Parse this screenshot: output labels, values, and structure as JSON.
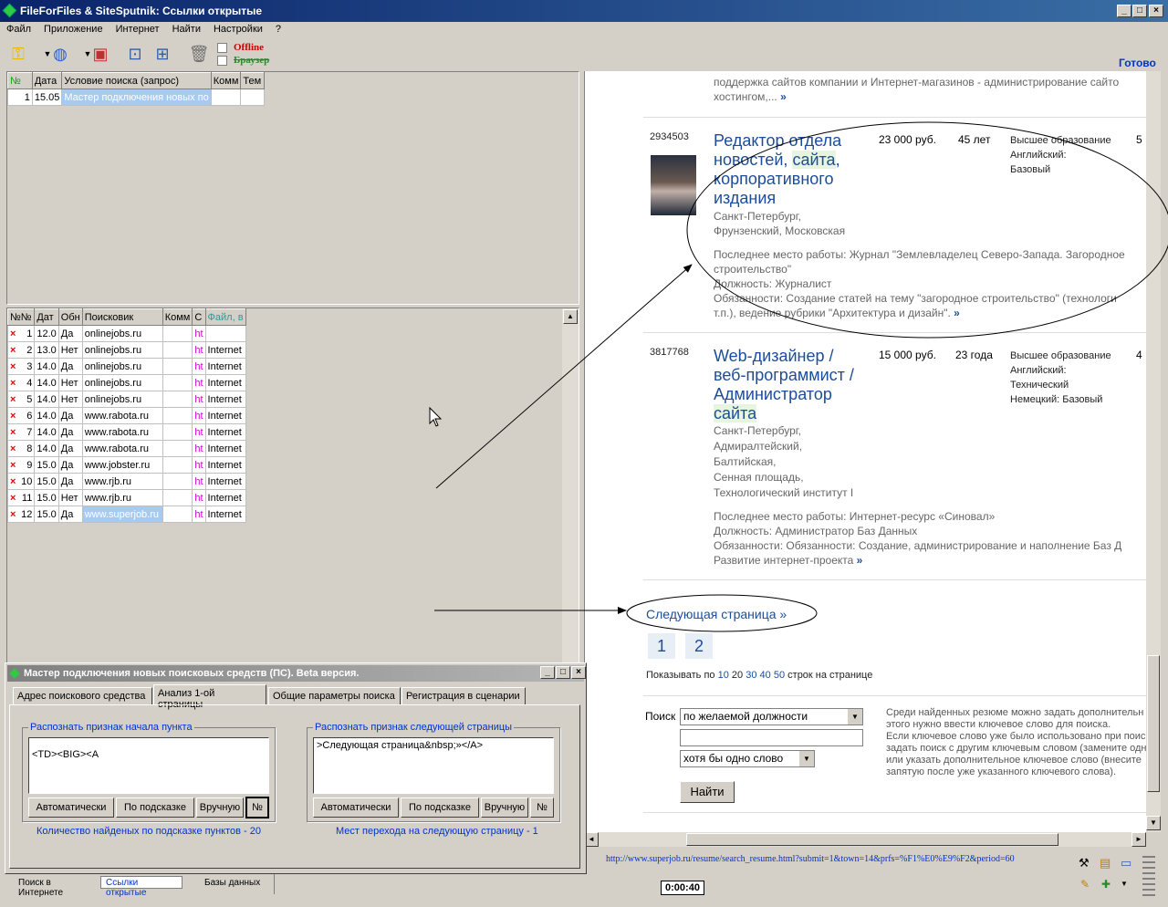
{
  "window": {
    "title": "FileForFiles & SiteSputnik: Ссылки открытые"
  },
  "menu": [
    "Файл",
    "Приложение",
    "Интернет",
    "Найти",
    "Настройки",
    "?"
  ],
  "toolbar": {
    "offline": "Offline",
    "browser": "Браузер",
    "status": "Готово"
  },
  "top_grid": {
    "headers": [
      "№",
      "Дата",
      "Условие поиска (запрос)",
      "Комм",
      "Тем"
    ],
    "rows": [
      [
        "1",
        "15.05",
        "Мастер подключения новых по",
        "",
        ""
      ]
    ]
  },
  "bottom_grid": {
    "headers": [
      "№№",
      "Дат",
      "Обн",
      "Поисковик",
      "Комм",
      "С",
      "Файл, в"
    ],
    "rows": [
      [
        "1",
        "12.0",
        "Да",
        "onlinejobs.ru",
        "",
        "ht",
        ""
      ],
      [
        "2",
        "13.0",
        "Нет",
        "onlinejobs.ru",
        "",
        "ht",
        "Internet"
      ],
      [
        "3",
        "14.0",
        "Да",
        "onlinejobs.ru",
        "",
        "ht",
        "Internet"
      ],
      [
        "4",
        "14.0",
        "Нет",
        "onlinejobs.ru",
        "",
        "ht",
        "Internet"
      ],
      [
        "5",
        "14.0",
        "Нет",
        "onlinejobs.ru",
        "",
        "ht",
        "Internet"
      ],
      [
        "6",
        "14.0",
        "Да",
        "www.rabota.ru",
        "",
        "ht",
        "Internet"
      ],
      [
        "7",
        "14.0",
        "Да",
        "www.rabota.ru",
        "",
        "ht",
        "Internet"
      ],
      [
        "8",
        "14.0",
        "Да",
        "www.rabota.ru",
        "",
        "ht",
        "Internet"
      ],
      [
        "9",
        "15.0",
        "Да",
        "www.jobster.ru",
        "",
        "ht",
        "Internet"
      ],
      [
        "10",
        "15.0",
        "Да",
        "www.rjb.ru",
        "",
        "ht",
        "Internet"
      ],
      [
        "11",
        "15.0",
        "Нет",
        "www.rjb.ru",
        "",
        "ht",
        "Internet"
      ],
      [
        "12",
        "15.0",
        "Да",
        "www.superjob.ru",
        "",
        "ht",
        "Internet"
      ]
    ]
  },
  "web": {
    "top_text": "поддержка сайтов компании и Интернет-магазинов - администрирование сайто",
    "top_text2": "хостингом,...",
    "v1": {
      "id": "2934503",
      "title1": "Редактор отдела",
      "title2": "новостей,",
      "title2hl": "сайта",
      "title2b": ",",
      "title3": "корпоративного",
      "title4": "издания",
      "salary": "23 000 руб.",
      "age": "45 лет",
      "edu": "Высшее образование",
      "lang1": "Английский:",
      "lang2": "Базовый",
      "num": "5",
      "city": "Санкт-Петербург,",
      "district": "Фрунзенский, Московская",
      "last": "Последнее место работы: Журнал \"Землевладелец Северо-Запада. Загородное",
      "last2": "строительство\"",
      "pos": "Должность: Журналист",
      "duty": "Обязанности: Создание статей на тему \"загородное строительство\" (технологи",
      "duty2": "т.п.), ведение рубрики \"Архитектура и дизайн\"."
    },
    "v2": {
      "id": "3817768",
      "title1": "Web-дизайнер /",
      "title2": "веб-программист /",
      "title3": "Администратор",
      "title4hl": "сайта",
      "salary": "15 000 руб.",
      "age": "23 года",
      "edu": "Высшее образование",
      "lang1": "Английский:",
      "lang2": "Технический",
      "lang3": "Немецкий: Базовый",
      "num": "4",
      "addr": [
        "Санкт-Петербург,",
        "Адмиралтейский,",
        "Балтийская,",
        "Сенная площадь,",
        "Технологический институт I"
      ],
      "last": "Последнее место работы: Интернет-ресурс «Синовал»",
      "pos": "Должность: Администратор Баз Данных",
      "duty": "Обязанности: Обязанности: Создание, администрирование и наполнение Баз Д",
      "duty2": "Развитие интернет-проекта"
    },
    "next_page": "Следующая страница »",
    "pages": [
      "1",
      "2"
    ],
    "show_prefix": "Показывать по",
    "show_opts": [
      "10",
      "20",
      "30",
      "40",
      "50"
    ],
    "show_suffix": "строк на странице",
    "search_label": "Поиск",
    "select1": "по желаемой должности",
    "select2": "хотя бы одно слово",
    "find_btn": "Найти",
    "hint": [
      "Среди найденных резюме можно задать дополнительн",
      "этого нужно ввести ключевое слово для поиска.",
      "Если ключевое слово уже было использовано при поиск",
      "задать поиск с другим ключевым словом (замените одн",
      "или указать дополнительное ключевое слово (внесите",
      "запятую после уже указанного ключевого слова)."
    ]
  },
  "dialog": {
    "title": "Мастер подключения новых поисковых средств (ПС). Beta версия.",
    "tabs": [
      "Адрес поискового средства",
      "Анализ 1-ой страницы",
      "Общие параметры поиска",
      "Регистрация в сценарии"
    ],
    "g1": {
      "legend": "Распознать признак начала пункта",
      "value": "<TD><BIG><A",
      "footer": "Количество найденых по подсказке пунктов - 20"
    },
    "g2": {
      "legend": "Распознать признак следующей страницы",
      "value": ">Следующая страница&nbsp;»</A>",
      "footer": "Мест перехода на следующую страницу - 1"
    },
    "buttons": [
      "Автоматически",
      "По подсказке",
      "Вручную",
      "№"
    ]
  },
  "statusbar": {
    "url": "http://www.superjob.ru/resume/search_resume.html?submit=1&town=14&prfs=%F1%E0%E9%F2&period=60",
    "timer": "0:00:40",
    "tabs": [
      "Поиск в Интернете",
      "Ссылки открытые",
      "Базы данных"
    ]
  }
}
